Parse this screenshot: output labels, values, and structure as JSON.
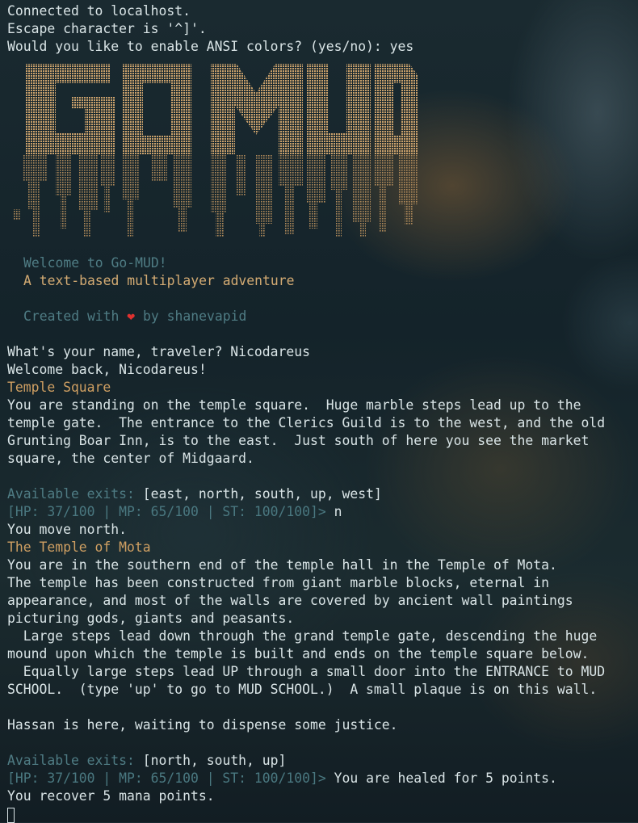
{
  "connection": {
    "connected": "Connected to localhost.",
    "escape": "Escape character is '^]'.",
    "ansi_prompt": "Would you like to enable ANSI colors? (yes/no): yes"
  },
  "banner": {
    "logo_text": "GO MUD",
    "logo_color": "#c9a06b",
    "welcome": "Welcome to Go-MUD!",
    "tagline": "A text-based multiplayer adventure",
    "created_prefix": "Created with",
    "heart_icon": "heart-icon",
    "created_suffix": "by shanevapid"
  },
  "session": {
    "name_prompt": "What's your name, traveler? Nicodareus",
    "welcome_back": "Welcome back, Nicodareus!"
  },
  "room1": {
    "title": "Temple Square",
    "desc": [
      "You are standing on the temple square.  Huge marble steps lead up to the",
      "temple gate.  The entrance to the Clerics Guild is to the west, and the old",
      "Grunting Boar Inn, is to the east.  Just south of here you see the market",
      "square, the center of Midgaard."
    ],
    "exits_label": "Available exits:",
    "exits": "[east, north, south, up, west]",
    "status_prompt": "[HP: 37/100 | MP: 65/100 | ST: 100/100]>",
    "command": " n"
  },
  "room2": {
    "move_msg": "You move north.",
    "title": "The Temple of Mota",
    "desc": [
      "You are in the southern end of the temple hall in the Temple of Mota.",
      "The temple has been constructed from giant marble blocks, eternal in",
      "appearance, and most of the walls are covered by ancient wall paintings",
      "picturing gods, giants and peasants.",
      "  Large steps lead down through the grand temple gate, descending the huge",
      "mound upon which the temple is built and ends on the temple square below.",
      "  Equally large steps lead UP through a small door into the ENTRANCE to MUD",
      "SCHOOL.  (type 'up' to go to MUD SCHOOL.)  A small plaque is on this wall."
    ],
    "npc": "Hassan is here, waiting to dispense some justice.",
    "exits_label": "Available exits:",
    "exits": "[north, south, up]",
    "status_prompt": "[HP: 37/100 | MP: 65/100 | ST: 100/100]>",
    "heal_msg": " You are healed for 5 points.",
    "mana_msg": "You recover 5 mana points."
  }
}
